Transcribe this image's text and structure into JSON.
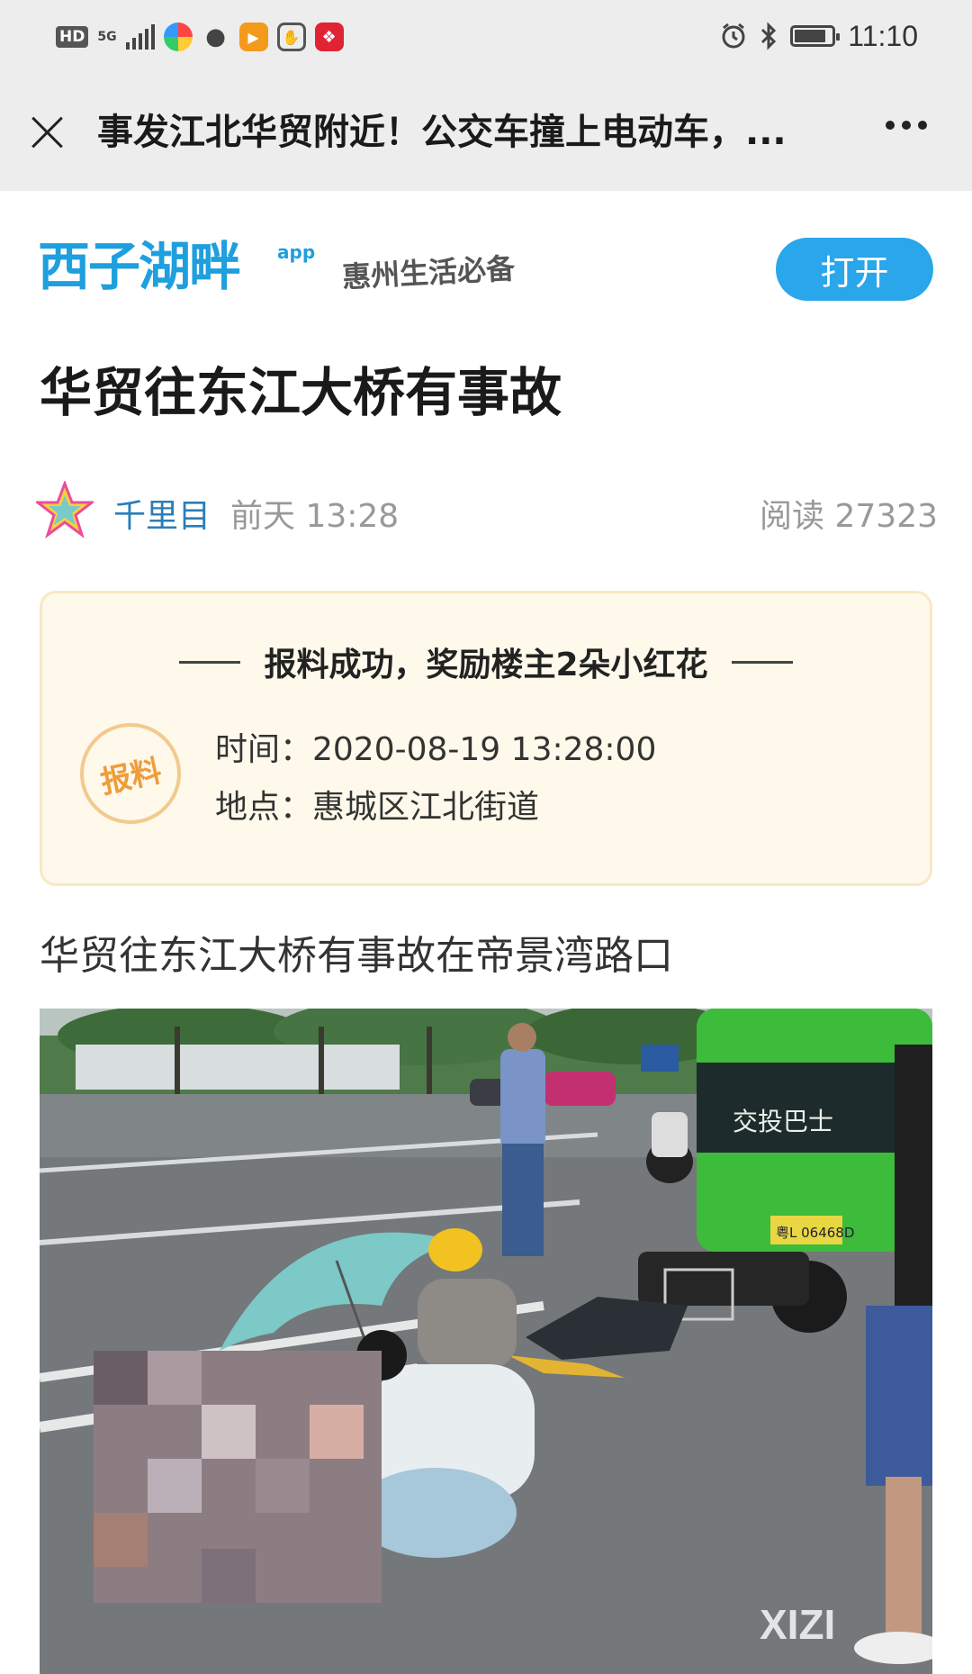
{
  "status_bar": {
    "hd": "HD",
    "network": "5G",
    "time": "11:10",
    "battery_level": 0.85
  },
  "nav": {
    "title": "事发江北华贸附近！公交车撞上电动车，..."
  },
  "banner": {
    "logo_text": "西子湖畔",
    "logo_suffix": "app",
    "slogan": "惠州生活必备",
    "open_label": "打开",
    "accent_color": "#2aa6ea"
  },
  "article": {
    "title": "华贸往东江大桥有事故",
    "author": "千里目",
    "posted": "前天 13:28",
    "read_count": "阅读 27323",
    "body": "华贸往东江大桥有事故在帝景湾路口"
  },
  "report_card": {
    "title": "报料成功，奖励楼主2朵小红花",
    "stamp": "报料",
    "time_line": "时间：2020-08-19 13:28:00",
    "place_line": "地点：惠城区江北街道"
  },
  "photo": {
    "bus_sign": "交投巴士",
    "plate": "粤L 06468D",
    "watermark": "XIZI"
  }
}
